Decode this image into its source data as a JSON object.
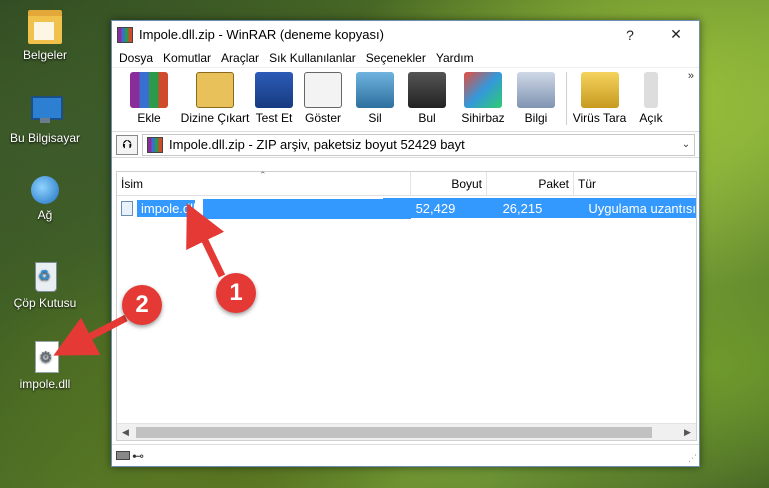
{
  "desktop": {
    "icons": [
      {
        "label": "Belgeler",
        "icon": "folder-icon"
      },
      {
        "label": "Bu Bilgisayar",
        "icon": "computer-icon"
      },
      {
        "label": "Ağ",
        "icon": "network-icon"
      },
      {
        "label": "Çöp Kutusu",
        "icon": "recycle-bin-icon"
      },
      {
        "label": "impole.dll",
        "icon": "dll-file-icon"
      }
    ]
  },
  "window": {
    "title": "Impole.dll.zip - WinRAR (deneme kopyası)",
    "help_label": "?",
    "close_label": "✕"
  },
  "menu": [
    "Dosya",
    "Komutlar",
    "Araçlar",
    "Sık Kullanılanlar",
    "Seçenekler",
    "Yardım"
  ],
  "toolbar": {
    "buttons": [
      "Ekle",
      "Dizine Çıkart",
      "Test Et",
      "Göster",
      "Sil",
      "Bul",
      "Sihirbaz",
      "Bilgi",
      "Virüs Tara",
      "Açık"
    ],
    "more": "»"
  },
  "pathbar": {
    "up_icon": "⮉",
    "text": "Impole.dll.zip - ZIP arşiv, paketsiz boyut 52429 bayt",
    "dropdown": "⌄"
  },
  "columns": [
    "İsim",
    "Boyut",
    "Paket",
    "Tür"
  ],
  "files": [
    {
      "name": "impole.dll",
      "size": "52,429",
      "packed": "26,215",
      "type": "Uygulama uzantısı"
    }
  ],
  "scroll": {
    "left": "◀",
    "right": "▶"
  },
  "statusbar": {
    "key": "⊷",
    "grip": "⋰"
  },
  "annotations": {
    "step1": "1",
    "step2": "2",
    "color": "#e53935"
  }
}
